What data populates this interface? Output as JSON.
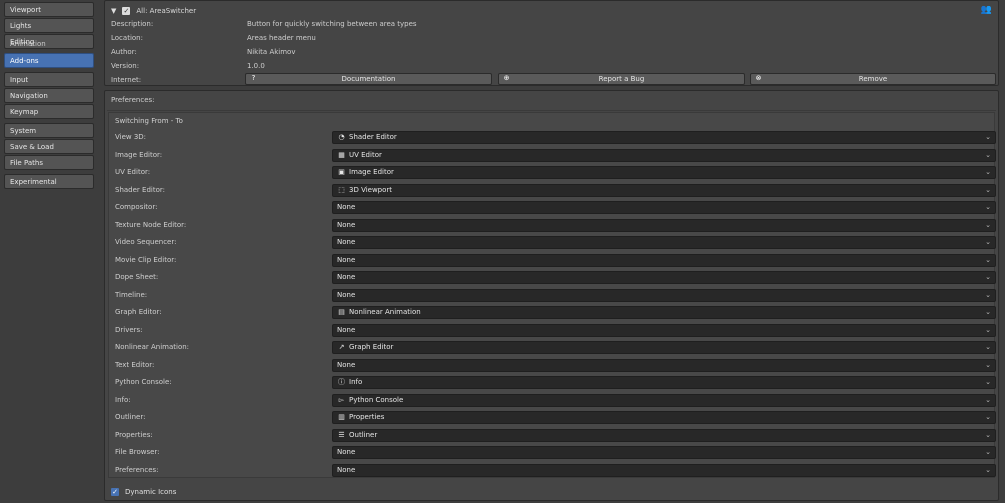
{
  "sidebar": {
    "groups": [
      [
        {
          "label": "Viewport",
          "active": false
        },
        {
          "label": "Lights",
          "active": false
        },
        {
          "label": "Editing",
          "active": false,
          "overlap": "Animation"
        }
      ],
      [
        {
          "label": "Add-ons",
          "active": true
        }
      ],
      [
        {
          "label": "Input",
          "active": false
        },
        {
          "label": "Navigation",
          "active": false
        },
        {
          "label": "Keymap",
          "active": false
        }
      ],
      [
        {
          "label": "System",
          "active": false
        },
        {
          "label": "Save & Load",
          "active": false
        },
        {
          "label": "File Paths",
          "active": false
        }
      ],
      [
        {
          "label": "Experimental",
          "active": false
        }
      ]
    ]
  },
  "addon": {
    "title": "All: AreaSwitcher",
    "rows": [
      {
        "key": "Description:",
        "value": "Button for quickly switching between area types"
      },
      {
        "key": "Location:",
        "value": "Areas header menu"
      },
      {
        "key": "Author:",
        "value": "Nikita Akimov"
      },
      {
        "key": "Version:",
        "value": "1.0.0"
      }
    ],
    "internet_label": "Internet:",
    "buttons": {
      "documentation": "Documentation",
      "report_bug": "Report a Bug",
      "remove": "Remove"
    },
    "icons": {
      "user": "user-icon",
      "documentation": "help-book-icon",
      "report_bug": "globe-bug-icon",
      "remove": "cancel-icon"
    }
  },
  "preferences": {
    "title": "Preferences:",
    "section_title": "Switching From - To",
    "rows": [
      {
        "label": "View 3D:",
        "value": "Shader Editor",
        "icon": "◔"
      },
      {
        "label": "Image Editor:",
        "value": "UV Editor",
        "icon": "▦"
      },
      {
        "label": "UV Editor:",
        "value": "Image Editor",
        "icon": "▣"
      },
      {
        "label": "Shader Editor:",
        "value": "3D Viewport",
        "icon": "⬚"
      },
      {
        "label": "Compositor:",
        "value": "None",
        "icon": ""
      },
      {
        "label": "Texture Node Editor:",
        "value": "None",
        "icon": ""
      },
      {
        "label": "Video Sequencer:",
        "value": "None",
        "icon": ""
      },
      {
        "label": "Movie Clip Editor:",
        "value": "None",
        "icon": ""
      },
      {
        "label": "Dope Sheet:",
        "value": "None",
        "icon": ""
      },
      {
        "label": "Timeline:",
        "value": "None",
        "icon": ""
      },
      {
        "label": "Graph Editor:",
        "value": "Nonlinear Animation",
        "icon": "▤"
      },
      {
        "label": "Drivers:",
        "value": "None",
        "icon": ""
      },
      {
        "label": "Nonlinear Animation:",
        "value": "Graph Editor",
        "icon": "↗"
      },
      {
        "label": "Text Editor:",
        "value": "None",
        "icon": ""
      },
      {
        "label": "Python Console:",
        "value": "Info",
        "icon": "ⓘ"
      },
      {
        "label": "Info:",
        "value": "Python Console",
        "icon": "▻"
      },
      {
        "label": "Outliner:",
        "value": "Properties",
        "icon": "▥"
      },
      {
        "label": "Properties:",
        "value": "Outliner",
        "icon": "☰"
      },
      {
        "label": "File Browser:",
        "value": "None",
        "icon": ""
      },
      {
        "label": "Preferences:",
        "value": "None",
        "icon": ""
      }
    ],
    "dynamic_icons_label": "Dynamic Icons",
    "dynamic_icons_checked": true
  },
  "colors": {
    "accent": "#4772b3",
    "background": "#3d3d3d",
    "panel": "#454545",
    "field": "#282828"
  }
}
